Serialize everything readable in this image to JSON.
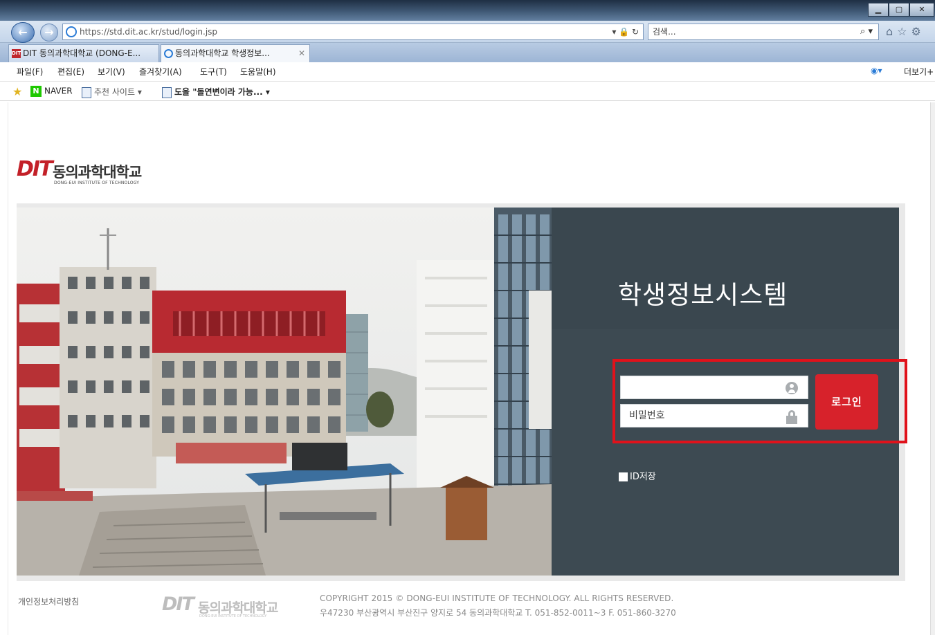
{
  "browser": {
    "url": "https://std.dit.ac.kr/stud/login.jsp",
    "search_placeholder": "검색...",
    "tabs": [
      {
        "label": "DIT 동의과학대학교 (DONG-E..."
      },
      {
        "label": "동의과학대학교 학생정보..."
      }
    ],
    "menu": [
      "파일(F)",
      "편집(E)",
      "보기(V)",
      "즐겨찾기(A)",
      "도구(T)",
      "도움말(H)"
    ],
    "more_label": "더보기+",
    "favorites": [
      {
        "label": "NAVER"
      },
      {
        "label": "추천 사이트"
      },
      {
        "label": "도올 \"돌연변이라 가능..."
      }
    ]
  },
  "site": {
    "logo_mark": "DIT",
    "logo_name": "동의과학대학교",
    "logo_subtitle": "DONG-EUI INSTITUTE OF TECHNOLOGY"
  },
  "login": {
    "title": "학생정보시스템",
    "password_placeholder": "비밀번호",
    "button_label": "로그인",
    "save_id_label": "ID저장"
  },
  "footer": {
    "privacy_link": "개인정보처리방침",
    "copyright": "COPYRIGHT 2015 © DONG-EUI INSTITUTE OF TECHNOLOGY. ALL RIGHTS RESERVED.",
    "address": "우47230 부산광역시 부산진구 양지로 54 동의과학대학교 T. 051-852-0011~3 F. 051-860-3270"
  },
  "colors": {
    "brand_red": "#d7222b",
    "panel_dark": "#3d4a52",
    "highlight_red": "#e0121b"
  }
}
